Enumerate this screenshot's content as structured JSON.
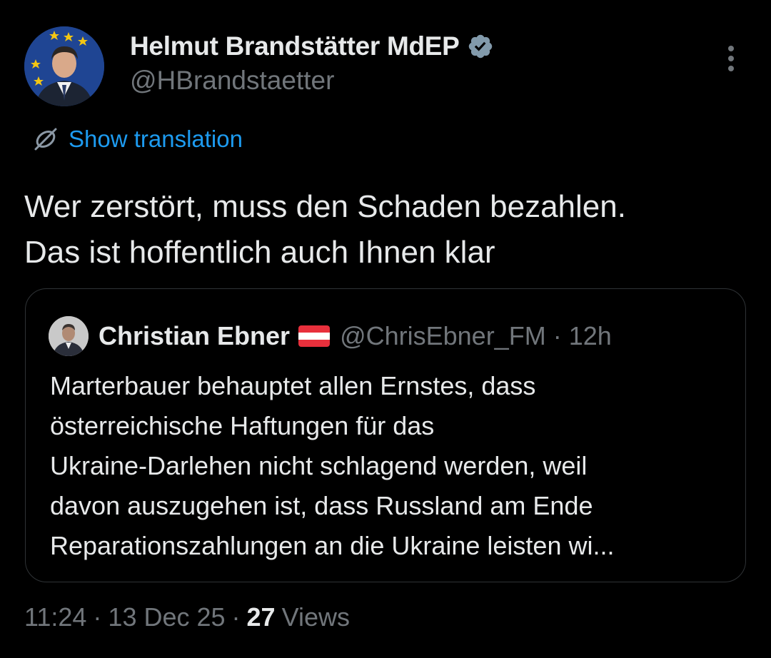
{
  "author": {
    "display_name": "Helmut Brandstätter MdEP",
    "handle": "@HBrandstaetter",
    "verified_icon": "verified-badge-icon",
    "avatar_icon": "avatar-photo"
  },
  "menu": {
    "icon": "more-vertical-icon"
  },
  "translation": {
    "icon": "translate-icon",
    "label": "Show translation"
  },
  "tweet": {
    "text": "Wer zerstört, muss den Schaden bezahlen.\nDas ist hoffentlich auch Ihnen klar"
  },
  "quote": {
    "display_name": "Christian Ebner",
    "flag_icon": "austria-flag-icon",
    "handle": "@ChrisEbner_FM",
    "separator": "·",
    "time": "12h",
    "text": "Marterbauer behauptet allen Ernstes, dass\nösterreichische Haftungen für das\nUkraine-Darlehen nicht schlagend werden, weil\ndavon auszugehen ist, dass Russland am Ende\nReparationszahlungen an die Ukraine leisten wi..."
  },
  "meta": {
    "time": "11:24",
    "separator": "·",
    "date": "13 Dec 25",
    "views_count": "27",
    "views_label": "Views"
  },
  "colors": {
    "background": "#000000",
    "text_primary": "#e7e9ea",
    "text_secondary": "#71767b",
    "link_blue": "#1d9bf0",
    "border": "#2f3336",
    "verified_badge": "#829aab"
  }
}
